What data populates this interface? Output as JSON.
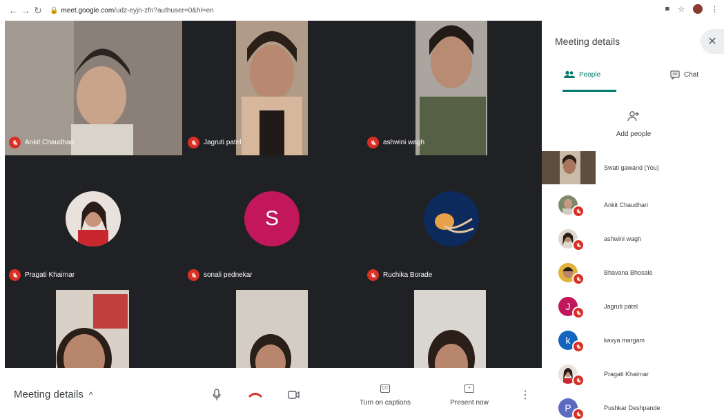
{
  "browser": {
    "url_domain": "meet.google.com",
    "url_rest": "/udz-eyjn-zfn?authuser=0&hl=en"
  },
  "tiles": [
    {
      "name": "Ankit Chaudhari"
    },
    {
      "name": "Jagruti patel"
    },
    {
      "name": "ashwini wagh"
    },
    {
      "name": "Pragati Khairnar"
    },
    {
      "name": "sonali pednekar",
      "letter": "S"
    },
    {
      "name": "Ruchika Borade"
    }
  ],
  "bottom": {
    "meeting_details": "Meeting details",
    "captions": "Turn on captions",
    "present": "Present now",
    "cc": "CC"
  },
  "panel": {
    "title": "Meeting details",
    "tab_people": "People",
    "tab_chat": "Chat",
    "add_people": "Add people",
    "people": [
      {
        "name": "Swati gawand (You)"
      },
      {
        "name": "Ankit Chaudhari"
      },
      {
        "name": "ashwini wagh"
      },
      {
        "name": "Bhavana Bhosale"
      },
      {
        "name": "Jagruti patel",
        "letter": "J",
        "color": "#c2185b"
      },
      {
        "name": "kavya margam",
        "letter": "k",
        "color": "#1565c0"
      },
      {
        "name": "Pragati Khairnar"
      },
      {
        "name": "Pushkar Deshpande",
        "letter": "P",
        "color": "#5c6bc0"
      }
    ]
  },
  "colors": {
    "accent": "#00796b",
    "mute": "#d93025",
    "grid_bg": "#202124",
    "end_call": "#d93025"
  }
}
